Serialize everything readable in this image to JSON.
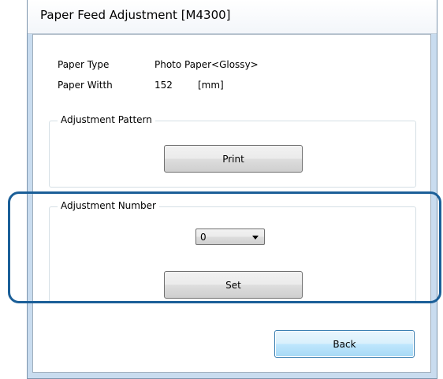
{
  "window": {
    "title": "Paper Feed Adjustment [M4300]"
  },
  "info": {
    "paper_type_label": "Paper Type",
    "paper_type_value": "Photo Paper<Glossy>",
    "paper_width_label": "Paper Witth",
    "paper_width_value": "152",
    "paper_width_unit": "[mm]"
  },
  "adjustment_pattern": {
    "legend": "Adjustment Pattern",
    "print_label": "Print"
  },
  "adjustment_number": {
    "legend": "Adjustment Number",
    "selected_value": "0",
    "set_label": "Set"
  },
  "footer": {
    "back_label": "Back"
  },
  "colors": {
    "highlight": "#1b5f98",
    "window_frame": "#c9dcef",
    "default_button": "#bee6fd"
  },
  "icons": {
    "dropdown": "chevron-down-icon"
  }
}
